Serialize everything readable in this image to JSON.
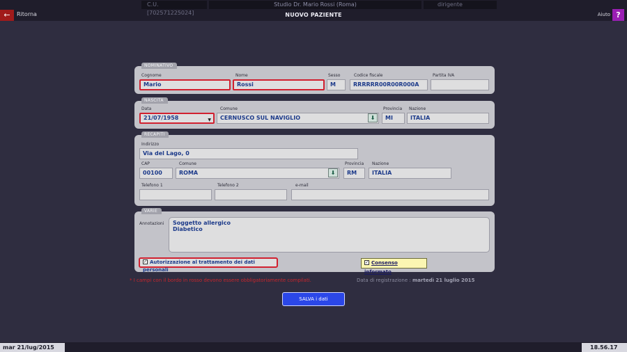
{
  "topbar": {
    "cu": "C.U. [702571225024]",
    "studio": "Studio Dr. Mario Rossi (Roma)",
    "role": "dirigente",
    "back_label": "Ritorna",
    "title": "NUOVO PAZIENTE",
    "help_label": "Aiuto",
    "help_icon": "?",
    "back_icon": "←"
  },
  "nominativo": {
    "section": "NOMINATIVO",
    "cognome_label": "Cognome",
    "cognome": "Mario",
    "nome_label": "Nome",
    "nome": "Rossi",
    "sesso_label": "Sesso",
    "sesso": "M",
    "cf_label": "Codice fiscale",
    "cf": "RRRRRR00R00R000A",
    "piva_label": "Partita IVA",
    "piva": ""
  },
  "nascita": {
    "section": "NASCITA",
    "data_label": "Data",
    "data": "21/07/1958",
    "comune_label": "Comune",
    "comune": "CERNUSCO SUL NAVIGLIO",
    "provincia_label": "Provincia",
    "provincia": "MI",
    "nazione_label": "Nazione",
    "nazione": "ITALIA"
  },
  "recapiti": {
    "section": "RECAPITI",
    "indirizzo_label": "Indirizzo",
    "indirizzo": "Via del Lago, 0",
    "cap_label": "CAP",
    "cap": "00100",
    "comune_label": "Comune",
    "comune": "ROMA",
    "provincia_label": "Provincia",
    "provincia": "RM",
    "nazione_label": "Nazione",
    "nazione": "ITALIA",
    "tel1_label": "Telefono 1",
    "tel1": "",
    "tel2_label": "Telefono 2",
    "tel2": "",
    "email_label": "e-mail",
    "email": ""
  },
  "varie": {
    "section": "VARIE",
    "annotazioni_label": "Annotazioni",
    "annotazioni_line1": "Soggetto allergico",
    "annotazioni_line2": "Diabetico",
    "privacy_label": "Autorizzazione al trattamento dei dati personali",
    "privacy_checked": true,
    "consenso_label": "Consenso informato",
    "consenso_checked": true,
    "check_mark": "✓"
  },
  "footer": {
    "required_note": "* I campi con il bordo in rosso devono essere obbligatoriamente compilati.",
    "reg_prefix": "Data di registrazione :",
    "reg_date": "martedì 21 luglio 2015",
    "save_label": "SALVA i dati"
  },
  "statusbar": {
    "date": "mar 21/lug/2015",
    "time": "18.56.17"
  },
  "colors": {
    "background": "#2f2d40",
    "required_border": "#d1202f",
    "value_text": "#1c3a8a",
    "save_button": "#2b47e8",
    "help_button": "#9a1fb4",
    "back_button": "#a11b1b"
  }
}
